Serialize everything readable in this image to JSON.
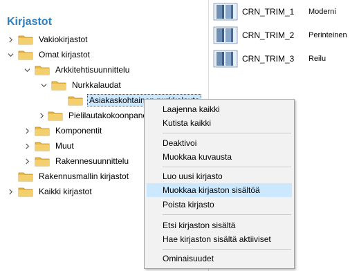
{
  "tree": {
    "title": "Kirjastot",
    "nodes": [
      {
        "label": "Vakiokirjastot"
      },
      {
        "label": "Omat kirjastot"
      },
      {
        "label": "Arkkitehtisuunnittelu"
      },
      {
        "label": "Nurkkalaudat"
      },
      {
        "label": "Asiakaskohtainen nurkkalauta"
      },
      {
        "label": "Pielilautakokoonpanot"
      },
      {
        "label": "Komponentit"
      },
      {
        "label": "Muut"
      },
      {
        "label": "Rakennesuunnittelu"
      },
      {
        "label": "Rakennusmallin kirjastot"
      },
      {
        "label": "Kaikki kirjastot"
      }
    ]
  },
  "library_items": [
    {
      "name": "CRN_TRIM_1",
      "kind": "Moderni"
    },
    {
      "name": "CRN_TRIM_2",
      "kind": "Perinteinen"
    },
    {
      "name": "CRN_TRIM_3",
      "kind": "Reilu"
    }
  ],
  "context_menu": {
    "items": [
      "Laajenna kaikki",
      "Kutista kaikki",
      "Deaktivoi",
      "Muokkaa kuvausta",
      "Luo uusi kirjasto",
      "Muokkaa kirjaston sisältöä",
      "Poista kirjasto",
      "Etsi kirjaston sisältä",
      "Hae kirjaston sisältä aktiiviset",
      "Ominaisuudet"
    ],
    "highlighted": "Muokkaa kirjaston sisältöä"
  },
  "colors": {
    "title": "#2c7fbe",
    "folder": "#e8b84a",
    "highlight": "#cce8ff"
  }
}
